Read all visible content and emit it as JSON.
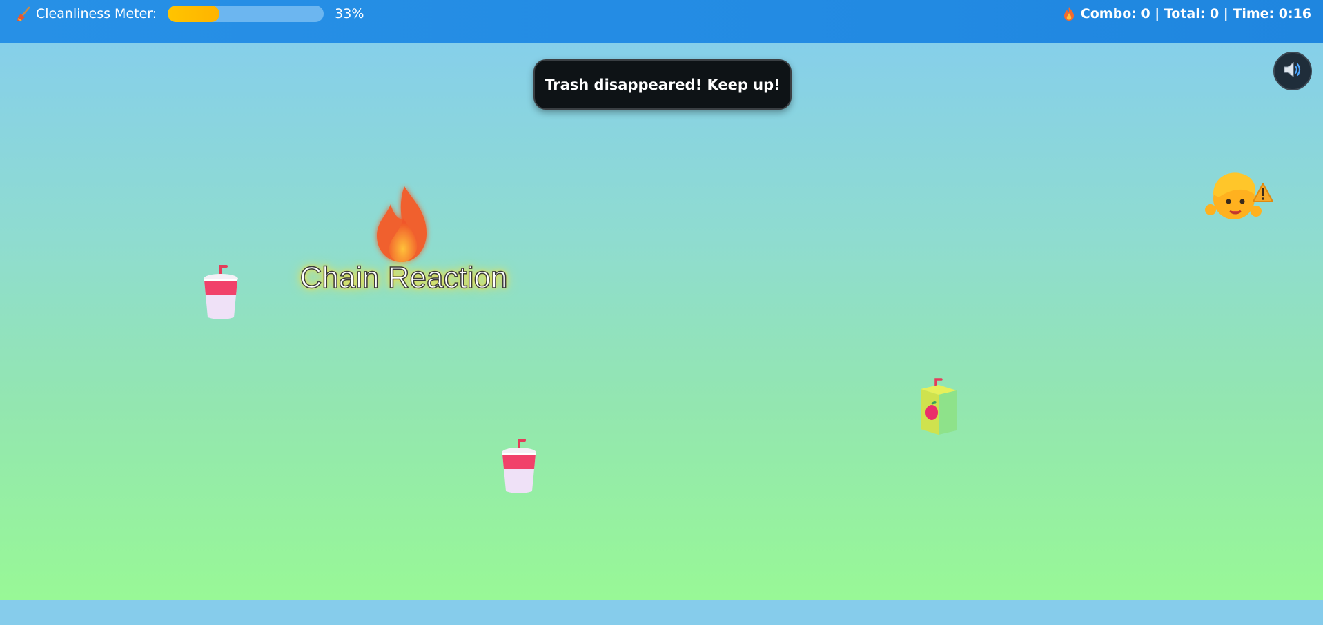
{
  "hud": {
    "meter_label": "Cleanliness Meter:",
    "meter_percent_text": "33%",
    "meter_value": 0.33,
    "stats_text": "Combo: 0 | Total: 0 | Time: 0:16",
    "icons": {
      "meter": "broom-icon",
      "stats": "fire-icon"
    }
  },
  "toast": {
    "message": "Trash disappeared! Keep up!"
  },
  "sound": {
    "icon": "speaker-icon"
  },
  "effects": {
    "chain_label": "Chain Reaction",
    "chain_icon": "fire-icon"
  },
  "sprites": [
    {
      "type": "soda-cup",
      "icon": "soda-cup-icon"
    },
    {
      "type": "soda-cup",
      "icon": "soda-cup-icon"
    },
    {
      "type": "juice-box",
      "icon": "juice-box-icon"
    },
    {
      "type": "worried-kid",
      "icon": "kid-face-icon"
    }
  ],
  "colors": {
    "topbar": "#238be3",
    "meter_fill": "#ffc400",
    "meter_track": "#6cb6f0",
    "toast_bg": "#0e1316",
    "field_top": "#86cfea",
    "field_bottom": "#98f896"
  }
}
